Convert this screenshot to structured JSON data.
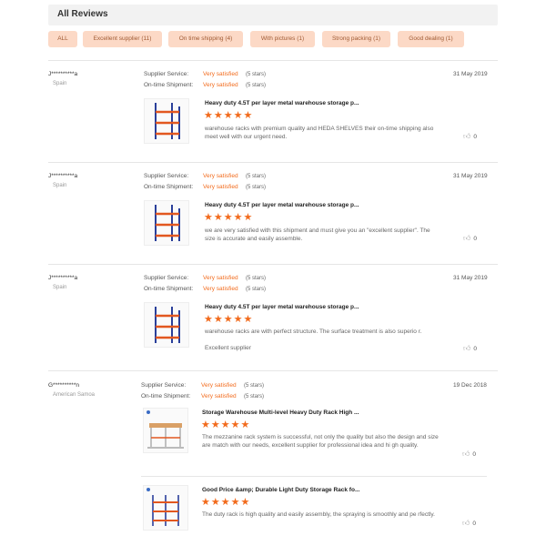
{
  "header": {
    "title": "All Reviews"
  },
  "filters": [
    {
      "label": "ALL"
    },
    {
      "label": "Excellent supplier (11)"
    },
    {
      "label": "On time shipping (4)"
    },
    {
      "label": "With pictures (1)"
    },
    {
      "label": "Strong packing (1)"
    },
    {
      "label": "Good dealing (1)"
    }
  ],
  "labels": {
    "supplier_service": "Supplier Service:",
    "ontime_shipment": "On-time Shipment:",
    "very_satisfied": "Very satisfied",
    "five_stars": "(5 stars)"
  },
  "reviews": [
    {
      "user": "J**********a",
      "country": "Spain",
      "date": "31 May 2019",
      "product_title": "Heavy duty 4.5T per layer metal warehouse storage p...",
      "rating": 5,
      "stars": "★★★★★",
      "comment": "warehouse racks with premium quality and HEDA SHELVES their on-time shipping also meet well with our urgent need.",
      "likes": "0"
    },
    {
      "user": "J**********a",
      "country": "Spain",
      "date": "31 May 2019",
      "product_title": "Heavy duty 4.5T per layer metal warehouse storage p...",
      "rating": 5,
      "stars": "★★★★★",
      "comment": "we are very satisfied with this shipment and must give you an \"excellent supplier\". The size is accurate and easily assemble.",
      "likes": "0"
    },
    {
      "user": "J**********a",
      "country": "Spain",
      "date": "31 May 2019",
      "product_title": "Heavy duty 4.5T per layer metal warehouse storage p...",
      "rating": 5,
      "stars": "★★★★★",
      "comment": "warehouse racks are with perfect structure. The surface treatment is also superio r.",
      "comment2": "Excellent supplier",
      "likes": "0"
    },
    {
      "user": "G**********n",
      "country": "American Samoa",
      "date": "19 Dec 2018",
      "product_title": "Storage Warehouse Multi-level Heavy Duty Rack High ...",
      "rating": 5,
      "stars": "★★★★★",
      "comment": "The mezzanine rack system is successful, not only the quality but also the design and size are match with our needs, excellent supplier for professional idea and hi gh quality.",
      "likes": "0",
      "sub": {
        "product_title": "Good Price &amp; Durable Light Duty Storage Rack fo...",
        "rating": 5,
        "stars": "★★★★★",
        "comment": "The duty rack is high quality and easily assembly, the spraying is smoothly and pe rfectly.",
        "likes": "0"
      }
    }
  ],
  "colors": {
    "accent": "#f26b1d",
    "chip_bg": "#fcd9c6",
    "rack_blue": "#2a3f9a",
    "rack_orange": "#e2571f"
  },
  "icons": {
    "like": "thumbs-up-icon"
  }
}
